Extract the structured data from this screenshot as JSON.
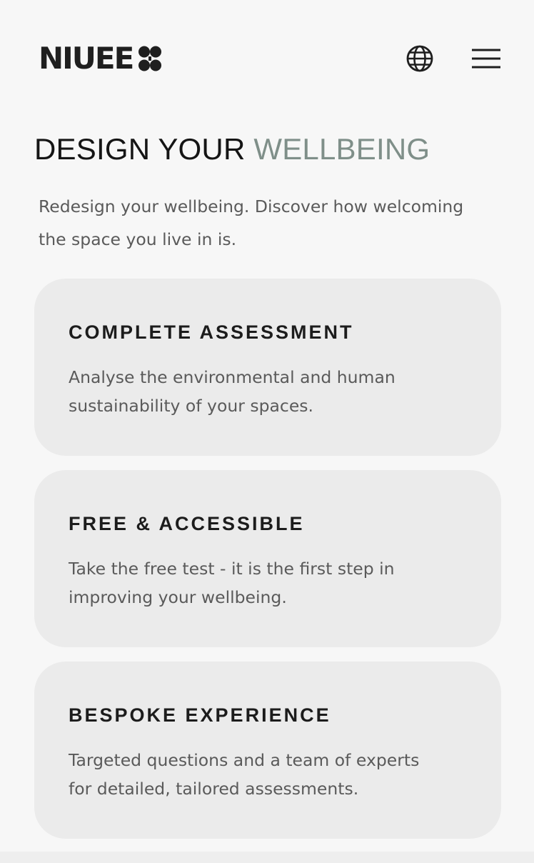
{
  "header": {
    "logo_text": "NIUEE",
    "globe_icon": "globe-icon",
    "menu_icon": "hamburger-menu-icon"
  },
  "hero": {
    "title_main": "DESIGN YOUR ",
    "title_accent": "WELLBEING",
    "subtitle": "Redesign your wellbeing. Discover how welcoming the space you live in is."
  },
  "cards": [
    {
      "title": "COMPLETE ASSESSMENT",
      "text": "Analyse the environmental and human sustainability of your spaces."
    },
    {
      "title": "FREE & ACCESSIBLE",
      "text": "Take the free test - it is the first step in improving your wellbeing."
    },
    {
      "title": "BESPOKE EXPERIENCE",
      "text": "Targeted questions and a team of experts for detailed, tailored assessments."
    }
  ],
  "colors": {
    "accent": "#7f8f89",
    "background": "#f7f7f7",
    "card": "#ebebeb",
    "text": "#1c1c1c",
    "muted": "#5a5a5a"
  }
}
